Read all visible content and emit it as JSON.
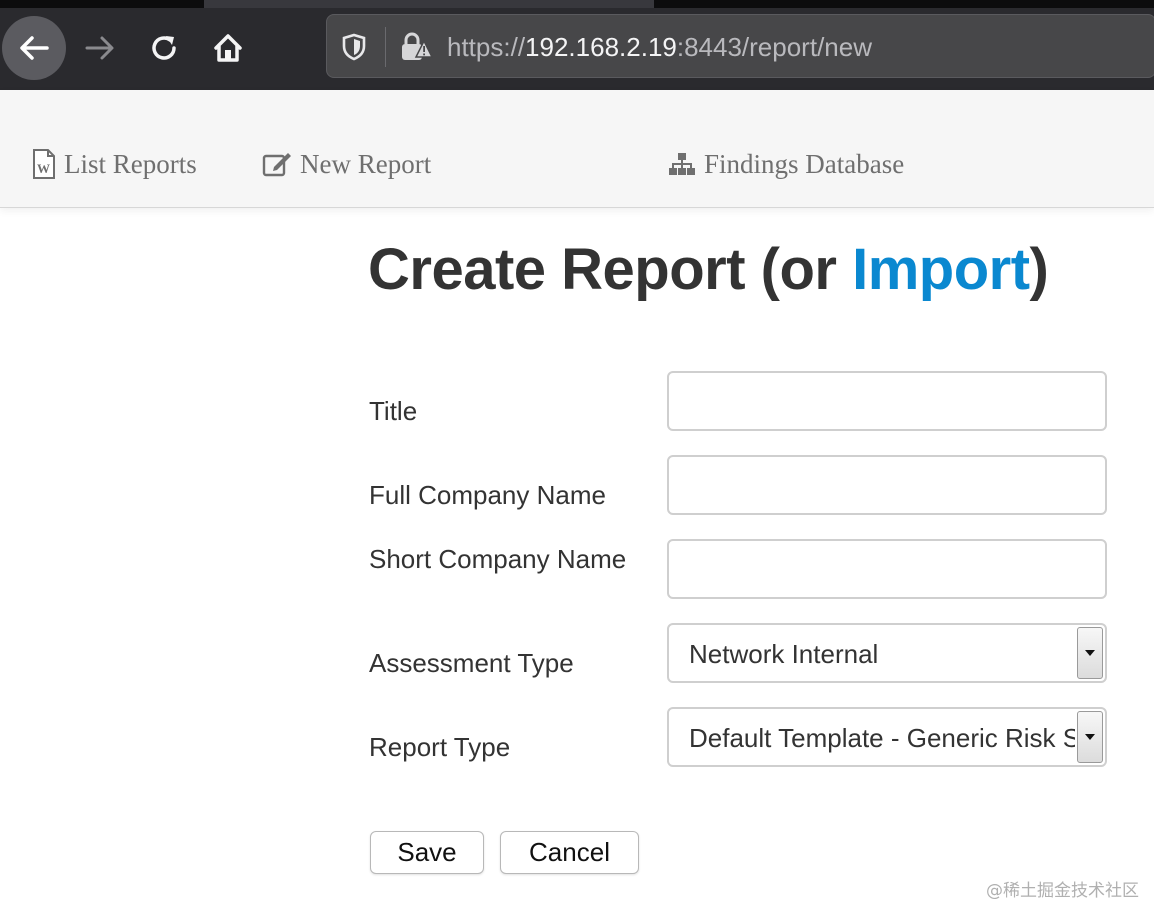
{
  "browser": {
    "url_scheme": "https://",
    "url_host": "192.168.2.19",
    "url_rest": ":8443/report/new",
    "icons": [
      "back-arrow-icon",
      "forward-arrow-icon",
      "reload-icon",
      "home-icon",
      "shield-icon",
      "insecure-lock-icon"
    ]
  },
  "nav": {
    "list_reports": "List Reports",
    "new_report": "New Report",
    "findings_database": "Findings Database",
    "icons": [
      "word-document-icon",
      "edit-icon",
      "sitemap-icon"
    ]
  },
  "page": {
    "heading_prefix": "Create Report (or ",
    "heading_link": "Import",
    "heading_suffix": ")"
  },
  "form": {
    "title_label": "Title",
    "title_value": "",
    "full_company_label": "Full Company Name",
    "full_company_value": "",
    "short_company_label": "Short Company Name",
    "short_company_value": "",
    "assessment_type_label": "Assessment Type",
    "assessment_type_value": "Network Internal",
    "report_type_label": "Report Type",
    "report_type_value": "Default Template - Generic Risk Scoring",
    "save_label": "Save",
    "cancel_label": "Cancel"
  },
  "watermark": "@稀土掘金技术社区",
  "colors": {
    "link": "#0a88d0",
    "heading": "#333333",
    "browser_chrome": "#2a2a2e"
  }
}
